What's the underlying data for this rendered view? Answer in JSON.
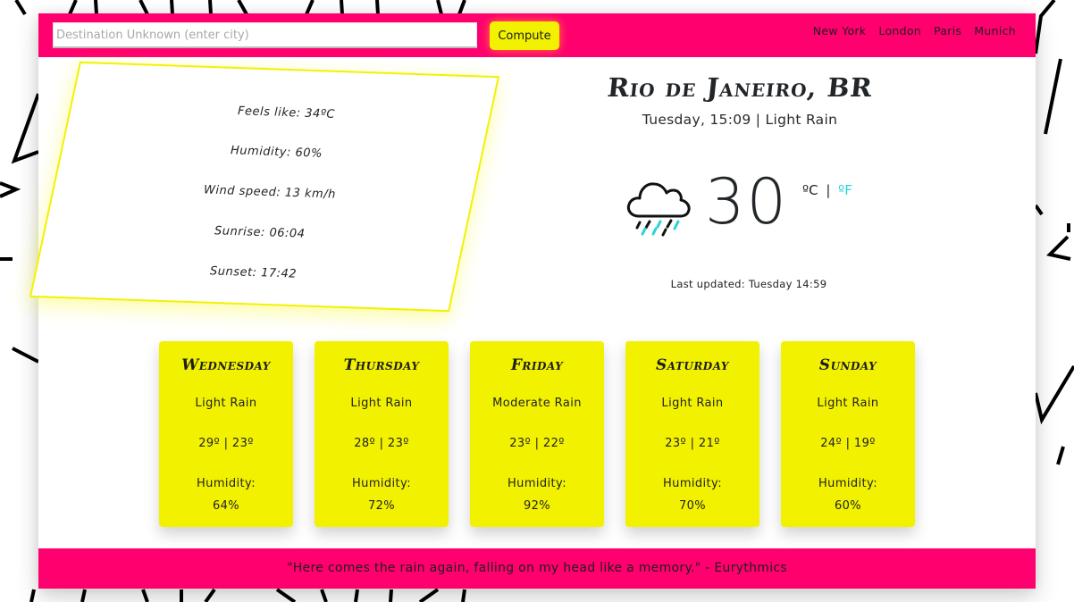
{
  "header": {
    "search_placeholder": "Destination Unknown (enter city)",
    "search_value": "",
    "compute_label": "Compute",
    "cities": [
      "New York",
      "London",
      "Paris",
      "Munich"
    ]
  },
  "details": {
    "feels_like": "Feels like: 34ºC",
    "humidity": "Humidity: 60%",
    "wind_speed": "Wind speed: 13 km/h",
    "sunrise": "Sunrise: 06:04",
    "sunset": "Sunset: 17:42"
  },
  "current": {
    "city": "Rio de Janeiro, BR",
    "subtitle": "Tuesday, 15:09 | Light Rain",
    "icon": "cloud-rain-icon",
    "temperature": "30",
    "unit_c": "ºC",
    "unit_separator": "|",
    "unit_f": "ºF",
    "last_updated": "Last updated: Tuesday 14:59"
  },
  "forecast": [
    {
      "day": "Wednesday",
      "description": "Light Rain",
      "temps": "29º | 23º",
      "humidity_label": "Humidity:",
      "humidity": "64%"
    },
    {
      "day": "Thursday",
      "description": "Light Rain",
      "temps": "28º | 23º",
      "humidity_label": "Humidity:",
      "humidity": "72%"
    },
    {
      "day": "Friday",
      "description": "Moderate Rain",
      "temps": "23º | 22º",
      "humidity_label": "Humidity:",
      "humidity": "92%"
    },
    {
      "day": "Saturday",
      "description": "Light Rain",
      "temps": "23º | 21º",
      "humidity_label": "Humidity:",
      "humidity": "70%"
    },
    {
      "day": "Sunday",
      "description": "Light Rain",
      "temps": "24º | 19º",
      "humidity_label": "Humidity:",
      "humidity": "60%"
    }
  ],
  "footer": {
    "quote": "\"Here comes the rain again, falling on my head like a memory.\" - Eurythmics"
  },
  "colors": {
    "accent_pink": "#ff006e",
    "accent_yellow": "#f2f200",
    "accent_cyan": "#2ad4d4",
    "text_dark": "#222629"
  }
}
